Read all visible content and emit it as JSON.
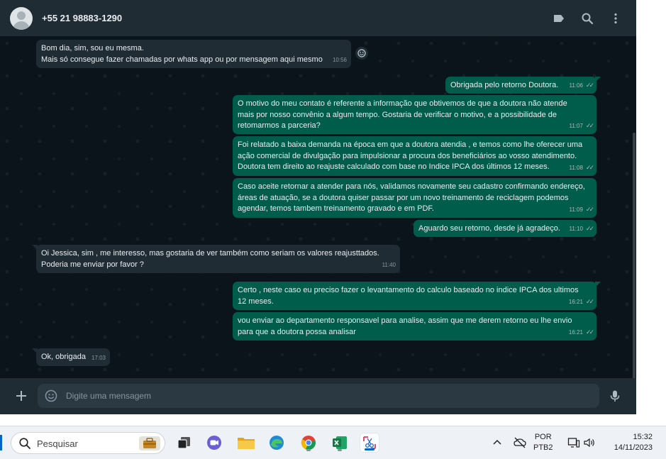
{
  "header": {
    "contact": "+55 21 98883-1290",
    "icons": [
      "label-icon",
      "search-icon",
      "menu-icon"
    ]
  },
  "messages": [
    {
      "dir": "in",
      "text": "Bom dia, sim, sou eu mesma.\nMais só consegue fazer chamadas por whats app ou por mensagem aqui mesmo",
      "time": "10:56"
    },
    {
      "dir": "out",
      "text": "Obrigada pelo retorno Doutora.",
      "time": "11:06"
    },
    {
      "dir": "out",
      "text": "O motivo do meu contato é referente a informação que obtivemos de que a doutora não atende\nmais por nosso convênio a algum tempo. Gostaria de verificar o motivo, e a possibilidade de\nretomarmos a parceria?",
      "time": "11:07"
    },
    {
      "dir": "out",
      "text": "Foi relatado a baixa demanda na época em que a doutora atendia , e temos como lhe oferecer uma\nação comercial de divulgação para impulsionar a procura dos beneficiários ao vosso atendimento.\nDoutora tem direito ao reajuste calculado com base no Indice IPCA dos últimos 12 meses.",
      "time": "11:08"
    },
    {
      "dir": "out",
      "text": "Caso aceite retornar a atender para nós, validamos novamente seu cadastro confirmando endereço,\náreas de atuação, se a doutora quiser passar por um novo treinamento de reciclagem podemos\nagendar, temos tambem treinamento gravado e em PDF.",
      "time": "11:09"
    },
    {
      "dir": "out",
      "text": "Aguardo seu retorno, desde já agradeço.",
      "time": "11:10"
    },
    {
      "dir": "in",
      "text": "Oi Jessica, sim , me interesso, mas gostaria de ver também como seriam os valores reajusttados.\nPoderia me enviar por favor ?",
      "time": "11:40"
    },
    {
      "dir": "out",
      "text": "Certo , neste caso eu preciso fazer o levantamento do calculo baseado no indice IPCA dos ultimos\n12 meses.",
      "time": "16:21"
    },
    {
      "dir": "out",
      "text": "vou enviar ao departamento responsavel para analise, assim que me derem retorno eu lhe envio\npara que a doutora possa analisar",
      "time": "16:21"
    },
    {
      "dir": "in",
      "text": "Ok, obrigada",
      "time": "17:03"
    }
  ],
  "composer": {
    "placeholder": "Digite uma mensagem"
  },
  "taskbar": {
    "search_placeholder": "Pesquisar",
    "lang_top": "POR",
    "lang_bottom": "PTB2",
    "time": "15:32",
    "date": "14/11/2023"
  },
  "colors": {
    "bg": "#0b141a",
    "panel": "#202c33",
    "bubble_in": "#202c33",
    "bubble_out": "#005c4b",
    "text": "#e9edef"
  }
}
